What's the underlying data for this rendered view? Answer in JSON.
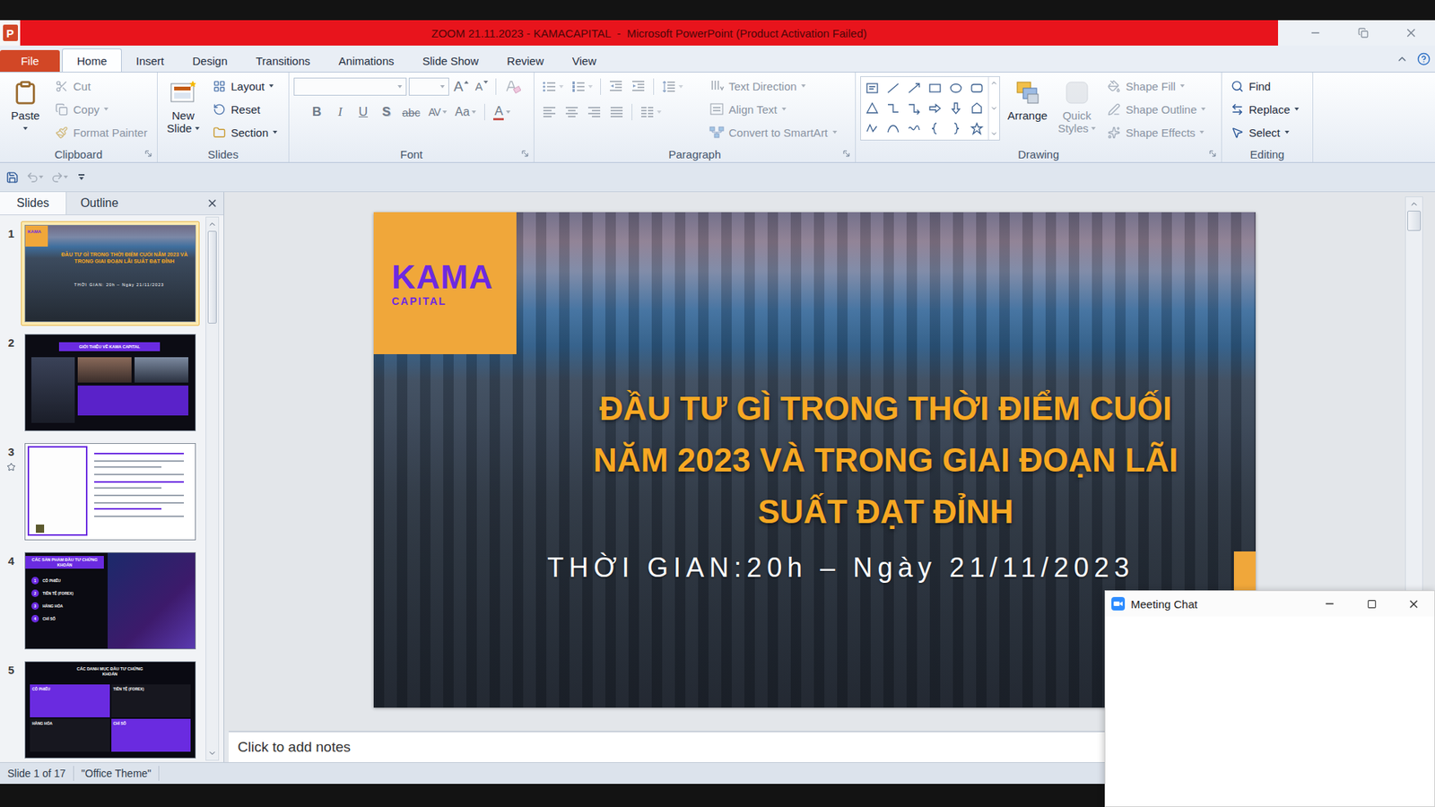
{
  "window": {
    "title": "ZOOM 21.11.2023 - KAMACAPITAL  -  Microsoft PowerPoint (Product Activation Failed)",
    "app_icon_letter": "P"
  },
  "ribbon_tabs": [
    {
      "label": "File",
      "kind": "file",
      "selected": false
    },
    {
      "label": "Home",
      "kind": "tab",
      "selected": true
    },
    {
      "label": "Insert",
      "kind": "tab",
      "selected": false
    },
    {
      "label": "Design",
      "kind": "tab",
      "selected": false
    },
    {
      "label": "Transitions",
      "kind": "tab",
      "selected": false
    },
    {
      "label": "Animations",
      "kind": "tab",
      "selected": false
    },
    {
      "label": "Slide Show",
      "kind": "tab",
      "selected": false
    },
    {
      "label": "Review",
      "kind": "tab",
      "selected": false
    },
    {
      "label": "View",
      "kind": "tab",
      "selected": false
    }
  ],
  "quick_access": [
    {
      "kind": "save",
      "disabled": false
    },
    {
      "kind": "undo",
      "disabled": true
    },
    {
      "kind": "redo",
      "disabled": true
    },
    {
      "kind": "customize",
      "disabled": false
    }
  ],
  "clipboard": {
    "label": "Clipboard",
    "paste": {
      "label_lines": [
        "Paste"
      ],
      "dropdown": true,
      "disabled": false
    },
    "commands": [
      {
        "label": "Cut",
        "dropdown": false,
        "disabled": true
      },
      {
        "label": "Copy",
        "dropdown": true,
        "disabled": true
      },
      {
        "label": "Format Painter",
        "dropdown": false,
        "disabled": true
      }
    ]
  },
  "slides_group": {
    "label": "Slides",
    "new_slide": {
      "label_lines": [
        "New",
        "Slide"
      ],
      "dropdown": true,
      "disabled": false
    },
    "commands": [
      {
        "label": "Layout",
        "dropdown": true,
        "disabled": false
      },
      {
        "label": "Reset",
        "dropdown": false,
        "disabled": false
      },
      {
        "label": "Section",
        "dropdown": true,
        "disabled": false
      }
    ]
  },
  "font_group": {
    "label": "Font",
    "disabled": true,
    "size_buttons": [
      {
        "label": "A",
        "kind": "grow"
      },
      {
        "label": "A",
        "kind": "shrink"
      }
    ],
    "format_buttons": [
      {
        "label": "B",
        "kind": "bold",
        "dropdown": false
      },
      {
        "label": "I",
        "kind": "italic",
        "dropdown": false
      },
      {
        "label": "U",
        "kind": "underline",
        "dropdown": false
      },
      {
        "label": "S",
        "kind": "shadow",
        "dropdown": false
      },
      {
        "label": "abc",
        "kind": "strike",
        "dropdown": false
      },
      {
        "label": "AV",
        "kind": "spacing",
        "dropdown": true
      },
      {
        "label": "Aa",
        "kind": "case",
        "dropdown": true
      },
      {
        "label": "A",
        "kind": "color",
        "dropdown": true
      }
    ]
  },
  "paragraph_group": {
    "label": "Paragraph",
    "icons_disabled": true,
    "commands": [
      {
        "label": "Text Direction",
        "dropdown": true,
        "disabled": true
      },
      {
        "label": "Align Text",
        "dropdown": true,
        "disabled": true
      },
      {
        "label": "Convert to SmartArt",
        "dropdown": true,
        "disabled": true
      }
    ]
  },
  "drawing_group": {
    "label": "Drawing",
    "large": [
      {
        "label_lines": [
          "Arrange"
        ],
        "dropdown": false,
        "disabled": false
      },
      {
        "label_lines": [
          "Quick",
          "Styles"
        ],
        "dropdown": true,
        "disabled": true
      }
    ],
    "commands": [
      {
        "label": "Shape Fill",
        "dropdown": true,
        "disabled": true
      },
      {
        "label": "Shape Outline",
        "dropdown": true,
        "disabled": true
      },
      {
        "label": "Shape Effects",
        "dropdown": true,
        "disabled": true
      }
    ]
  },
  "editing_group": {
    "label": "Editing",
    "commands": [
      {
        "label": "Find",
        "dropdown": false,
        "disabled": false
      },
      {
        "label": "Replace",
        "dropdown": true,
        "disabled": false
      },
      {
        "label": "Select",
        "dropdown": true,
        "disabled": false
      }
    ]
  },
  "slides_panel": {
    "tabs": [
      {
        "label": "Slides",
        "selected": true
      },
      {
        "label": "Outline",
        "selected": false
      }
    ],
    "scrollbar": {
      "position": 0,
      "size": 0.18
    },
    "thumbnails": [
      {
        "number": "1",
        "kind": "title",
        "selected": true,
        "transition": false,
        "logo": "KAMA",
        "title": "ĐẦU TƯ GÌ TRONG THỜI ĐIỂM CUỐI NĂM 2023 VÀ TRONG GIAI ĐOẠN LÃI SUẤT ĐẠT ĐỈNH",
        "subtitle": "THỜI GIAN: 20h – Ngày 21/11/2023"
      },
      {
        "number": "2",
        "kind": "intro",
        "selected": false,
        "transition": false,
        "title": "GIỚI THIỆU VỀ KAMA CAPITAL"
      },
      {
        "number": "3",
        "kind": "document",
        "selected": false,
        "transition": true
      },
      {
        "number": "4",
        "kind": "list",
        "selected": false,
        "transition": false,
        "title": "CÁC SẢN PHẨM ĐẦU TƯ CHỨNG KHOÁN",
        "items": [
          {
            "marker": "1",
            "label": "CỔ PHIẾU"
          },
          {
            "marker": "2",
            "label": "TIỀN TỆ (FOREX)"
          },
          {
            "marker": "3",
            "label": "HÀNG HÓA"
          },
          {
            "marker": "4",
            "label": "CHỈ SỐ"
          }
        ]
      },
      {
        "number": "5",
        "kind": "grid",
        "selected": false,
        "transition": false,
        "title": "CÁC DANH MỤC ĐẦU TƯ CHỨNG KHOÁN",
        "items": [
          {
            "label": "CỔ PHIẾU",
            "color": "#6a2be0"
          },
          {
            "label": "TIỀN TỆ (FOREX)",
            "color": "#17171f"
          },
          {
            "label": "HÀNG HÓA",
            "color": "#17171f"
          },
          {
            "label": "CHỈ SỐ",
            "color": "#6a2be0"
          }
        ]
      }
    ]
  },
  "slide": {
    "logo": {
      "name": "KAMA",
      "sub": "CAPITAL"
    },
    "title_lines": [
      "ĐẦU TƯ GÌ TRONG THỜI ĐIỂM CUỐI",
      "NĂM 2023 VÀ TRONG GIAI ĐOẠN LÃI",
      "SUẤT ĐẠT ĐỈNH"
    ],
    "date": "THỜI GIAN:20h – Ngày 21/11/2023"
  },
  "editor_scrollbar": {
    "position": 0,
    "size": 0.04
  },
  "notes": {
    "placeholder": "Click to add notes"
  },
  "status_bar": {
    "items": [
      "Slide 1 of 17",
      "\"Office Theme\""
    ]
  },
  "meeting_chat": {
    "title": "Meeting Chat"
  }
}
